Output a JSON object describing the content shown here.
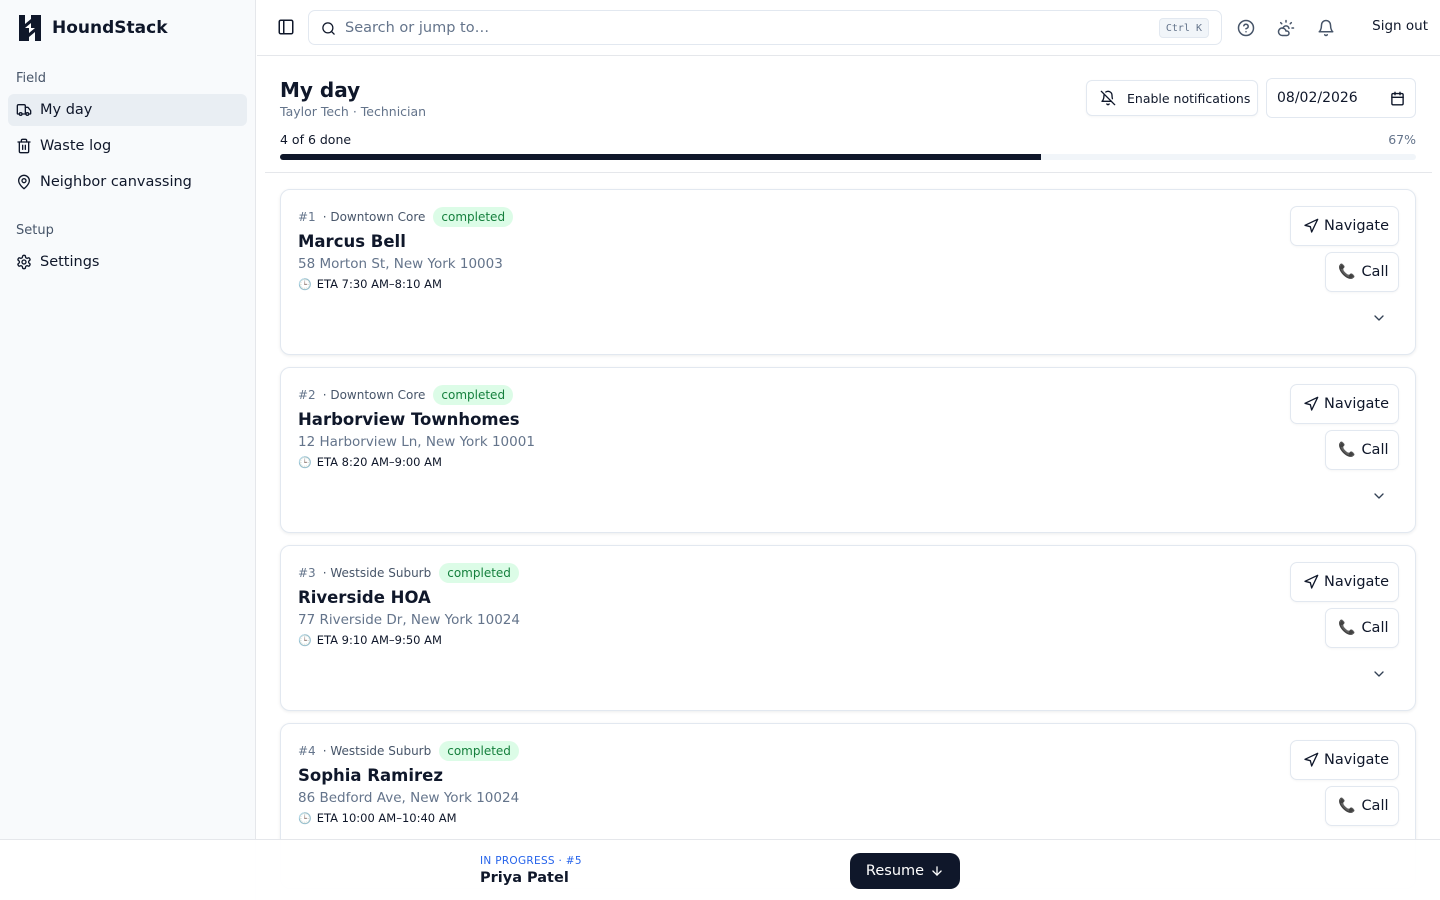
{
  "brand": {
    "name": "HoundStack",
    "logo": "houndstack-logo"
  },
  "sidebar": {
    "sections": [
      {
        "label": "Field"
      },
      {
        "label": "Setup"
      }
    ],
    "items": [
      {
        "label": "My day",
        "icon": "truck-icon",
        "active": true
      },
      {
        "label": "Waste log",
        "icon": "trash-icon"
      },
      {
        "label": "Neighbor canvassing",
        "icon": "map-pin-icon"
      },
      {
        "label": "Settings",
        "icon": "gear-icon"
      }
    ]
  },
  "topbar": {
    "search_placeholder": "Search or jump to…",
    "shortcut": "Ctrl K",
    "signout_label": "Sign out"
  },
  "header": {
    "title": "My day",
    "subtitle": "Taylor Tech · Technician",
    "enable_notifications": "Enable notifications",
    "date": "08/02/2026"
  },
  "progress": {
    "label": "4 of 6 done",
    "percent_label": "67%",
    "fraction": 0.67
  },
  "actions": {
    "navigate_label": "Navigate",
    "call_label": "Call"
  },
  "stops": [
    {
      "num": "#1",
      "region": "· Downtown Core",
      "status": "completed",
      "name": "Marcus Bell",
      "address": "58 Morton St, New York 10003",
      "eta": "ETA 7:30 AM–8:10 AM"
    },
    {
      "num": "#2",
      "region": "· Downtown Core",
      "status": "completed",
      "name": "Harborview Townhomes",
      "address": "12 Harborview Ln, New York 10001",
      "eta": "ETA 8:20 AM–9:00 AM"
    },
    {
      "num": "#3",
      "region": "· Westside Suburb",
      "status": "completed",
      "name": "Riverside HOA",
      "address": "77 Riverside Dr, New York 10024",
      "eta": "ETA 9:10 AM–9:50 AM"
    },
    {
      "num": "#4",
      "region": "· Westside Suburb",
      "status": "completed",
      "name": "Sophia Ramirez",
      "address": "86 Bedford Ave, New York 10024",
      "eta": "ETA 10:00 AM–10:40 AM"
    }
  ],
  "bottom_bar": {
    "status": "IN PROGRESS · #5",
    "name": "Priya Patel",
    "resume_label": "Resume"
  },
  "colors": {
    "primary": "#0f172a",
    "badge_bg": "#dcfce7",
    "badge_text": "#15803d",
    "status_blue": "#2563eb"
  }
}
